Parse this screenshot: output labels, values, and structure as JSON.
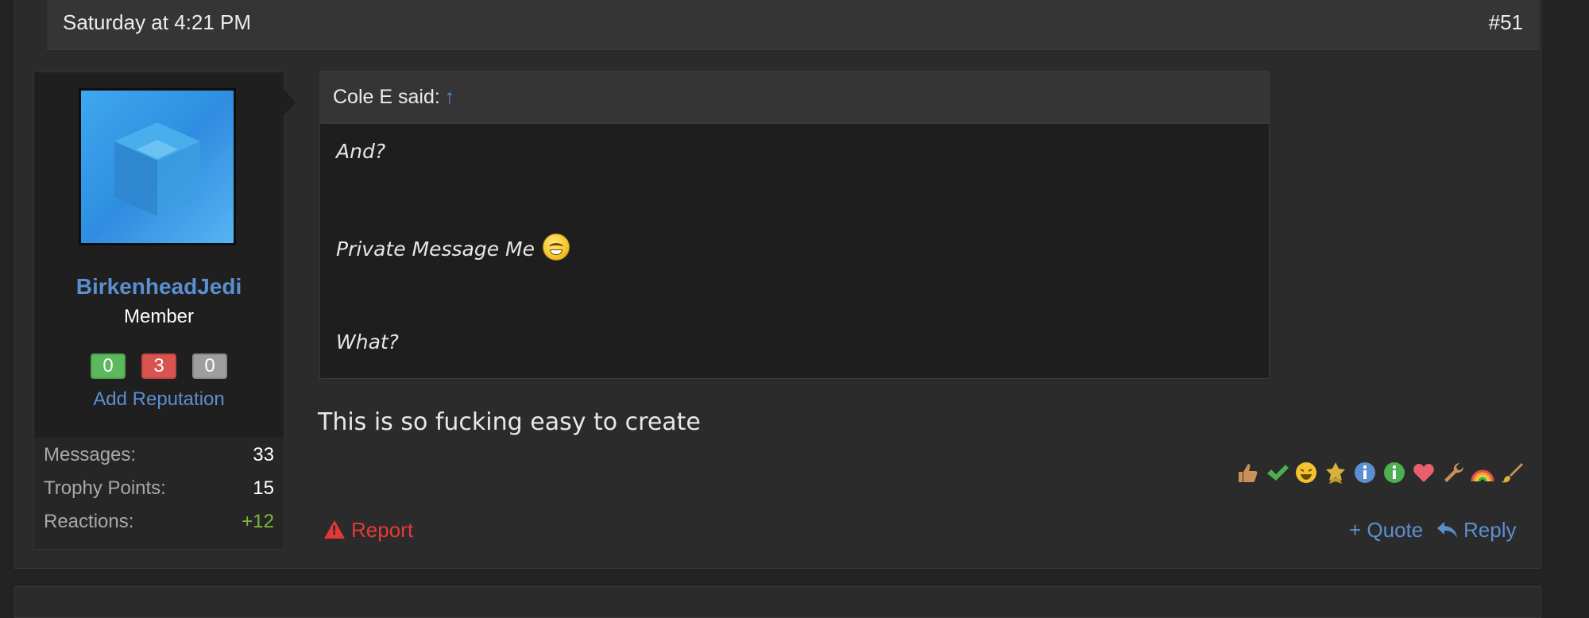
{
  "post": {
    "date": "Saturday at 4:21 PM",
    "number": "#51",
    "body": "This is so fucking easy to create"
  },
  "user": {
    "name": "BirkenheadJedi",
    "title": "Member",
    "reputation": {
      "positive": "0",
      "negative": "3",
      "neutral": "0"
    },
    "add_reputation": "Add Reputation",
    "stats": [
      {
        "label": "Messages:",
        "value": "33"
      },
      {
        "label": "Trophy Points:",
        "value": "15"
      },
      {
        "label": "Reactions:",
        "value": "+12"
      }
    ]
  },
  "quote": {
    "author": "Cole E said:",
    "arrow": "↑",
    "lines": [
      "And?",
      "Private Message Me",
      "What?"
    ]
  },
  "reactions": [
    {
      "icon": "thumbs-up-icon",
      "color": "#c8915a"
    },
    {
      "icon": "checkmark-icon",
      "color": "#4caf50"
    },
    {
      "icon": "laugh-icon",
      "color": "#f2c230"
    },
    {
      "icon": "award-icon",
      "color": "#d8b23a"
    },
    {
      "icon": "info-blue-icon",
      "color": "#5b8fcf"
    },
    {
      "icon": "info-green-icon",
      "color": "#4caf50"
    },
    {
      "icon": "heart-icon",
      "color": "#e8606e"
    },
    {
      "icon": "wrench-icon",
      "color": "#c8915a"
    },
    {
      "icon": "rainbow-icon",
      "color": "#e6504f"
    },
    {
      "icon": "brush-icon",
      "color": "#d8b23a"
    }
  ],
  "actions": {
    "report": "Report",
    "quote": "+ Quote",
    "reply": "Reply"
  }
}
